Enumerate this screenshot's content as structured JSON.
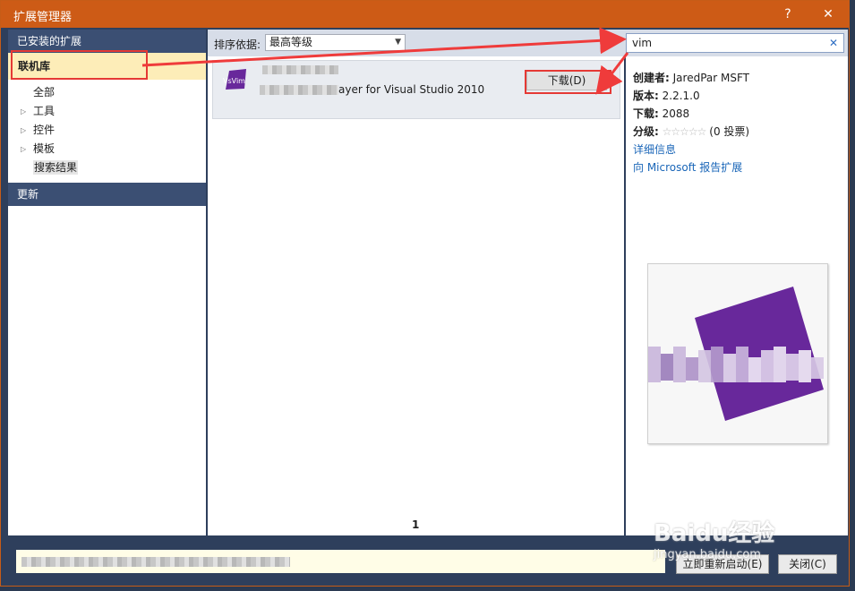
{
  "window": {
    "title": "扩展管理器",
    "help": "?",
    "close": "✕"
  },
  "sidebar": {
    "installed": "已安装的扩展",
    "online": "联机库",
    "items": [
      {
        "label": "全部",
        "expandable": false
      },
      {
        "label": "工具",
        "expandable": true
      },
      {
        "label": "控件",
        "expandable": true
      },
      {
        "label": "模板",
        "expandable": true
      },
      {
        "label": "搜索结果",
        "expandable": false
      }
    ],
    "updates": "更新"
  },
  "toolbar": {
    "sort_label": "排序依据:",
    "sort_value": "最高等级"
  },
  "search": {
    "value": "vim",
    "clear": "✕"
  },
  "results": [
    {
      "icon_text": "VsVim",
      "name": "VsVim",
      "description": "ayer for Visual Studio 2010",
      "download_label": "下载(D)"
    }
  ],
  "pagination": {
    "page": "1"
  },
  "details": {
    "creator_label": "创建者:",
    "creator": "JaredPar MSFT",
    "version_label": "版本:",
    "version": "2.2.1.0",
    "downloads_label": "下载:",
    "downloads": "2088",
    "rating_label": "分级:",
    "rating_votes": "(0 投票)",
    "more_info": "详细信息",
    "report": "向 Microsoft 报告扩展"
  },
  "footer": {
    "restart": "立即重新启动(E)",
    "close": "关闭(C)"
  },
  "watermark": {
    "text": "Baidu经验",
    "sub": "jingyan.baidu.com"
  },
  "colors": {
    "accent": "#cd5b16",
    "header": "#3b4f73",
    "link": "#1a66b8",
    "highlight": "#fdedb8",
    "vsvim": "#68289b"
  }
}
